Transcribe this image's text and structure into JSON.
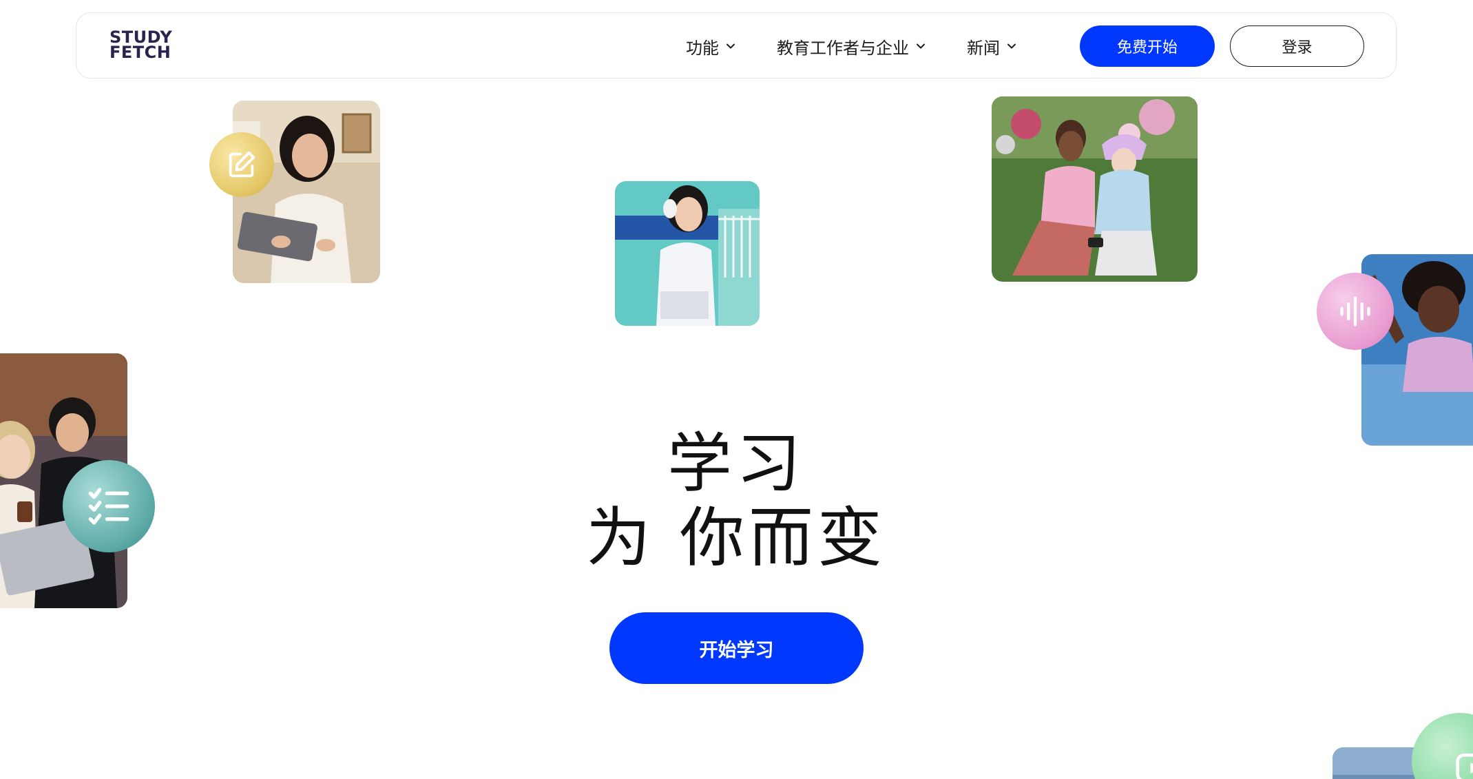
{
  "brand": {
    "logo_line1": "STUDY",
    "logo_line2": "FETCH"
  },
  "nav": {
    "items": [
      {
        "label": "功能"
      },
      {
        "label": "教育工作者与企业"
      },
      {
        "label": "新闻"
      }
    ],
    "signup_label": "免费开始",
    "login_label": "登录"
  },
  "hero": {
    "line1": "学习",
    "line2": "为 你而变",
    "cta_label": "开始学习"
  },
  "colors": {
    "accent": "#0038ff",
    "logo": "#2a2350",
    "badge_edit": "#e9cf6a",
    "badge_audio": "#e79ad0",
    "badge_checklist": "#5aa8a5",
    "badge_video": "#7ed89a"
  },
  "icons": [
    "chevron-down-icon",
    "edit-icon",
    "audio-waveform-icon",
    "checklist-icon",
    "play-icon"
  ]
}
